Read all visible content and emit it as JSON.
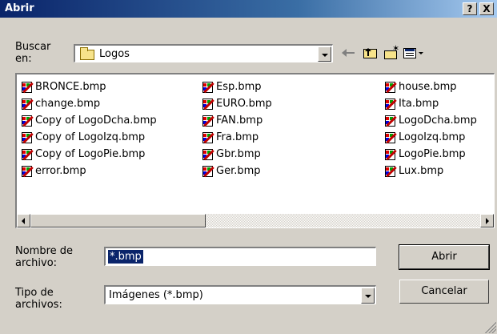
{
  "window": {
    "title": "Abrir",
    "help_label": "?",
    "close_label": "X"
  },
  "look_in": {
    "label_line1": "Buscar",
    "label_line2": "en:",
    "value": "Logos"
  },
  "toolbar": {
    "icons": [
      "back-arrow-icon",
      "up-folder-icon",
      "new-folder-icon",
      "view-menu-icon"
    ]
  },
  "files": {
    "col1": [
      "BRONCE.bmp",
      "change.bmp",
      "Copy of LogoDcha.bmp",
      "Copy of LogoIzq.bmp",
      "Copy of LogoPie.bmp",
      "error.bmp"
    ],
    "col2": [
      "Esp.bmp",
      "EURO.bmp",
      "FAN.bmp",
      "Fra.bmp",
      "Gbr.bmp",
      "Ger.bmp"
    ],
    "col3": [
      "house.bmp",
      "Ita.bmp",
      "LogoDcha.bmp",
      "LogoIzq.bmp",
      "LogoPie.bmp",
      "Lux.bmp"
    ]
  },
  "file_name": {
    "label_line1": "Nombre de",
    "label_line2": "archivo:",
    "value": "*.bmp"
  },
  "file_type": {
    "label_line1": "Tipo de",
    "label_line2": "archivos:",
    "value": "Imágenes (*.bmp)"
  },
  "buttons": {
    "open": "Abrir",
    "cancel": "Cancelar"
  },
  "colors": {
    "title_bar": "#0a246a",
    "face": "#d4d0c8",
    "selection": "#0a246a"
  }
}
